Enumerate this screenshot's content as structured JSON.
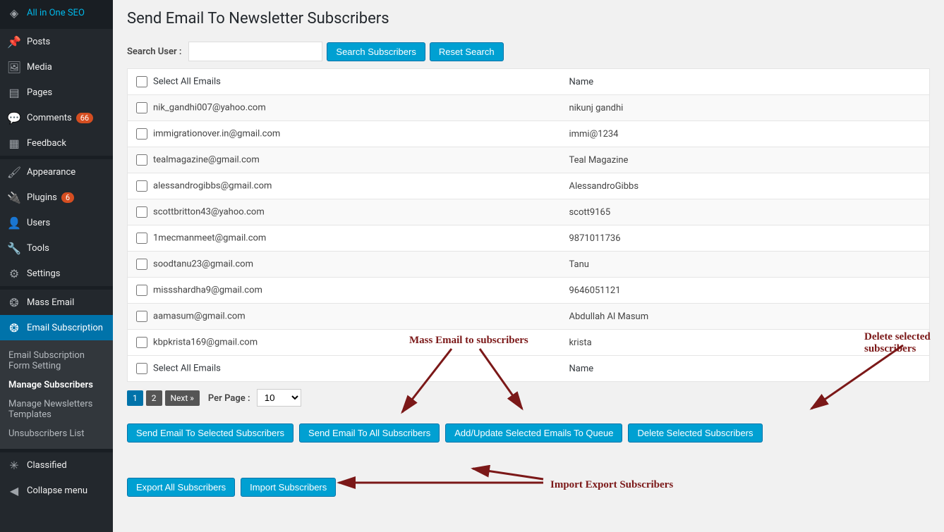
{
  "sidebar": {
    "items": [
      {
        "label": "All in One SEO",
        "icon": "●"
      },
      {
        "label": "Posts",
        "icon": "✎"
      },
      {
        "label": "Media",
        "icon": "▣"
      },
      {
        "label": "Pages",
        "icon": "▤"
      },
      {
        "label": "Comments",
        "icon": "💬",
        "badge": "66"
      },
      {
        "label": "Feedback",
        "icon": "▦"
      },
      {
        "label": "Appearance",
        "icon": "✂"
      },
      {
        "label": "Plugins",
        "icon": "⚡",
        "badge": "6"
      },
      {
        "label": "Users",
        "icon": "👤"
      },
      {
        "label": "Tools",
        "icon": "🔧"
      },
      {
        "label": "Settings",
        "icon": "⚙"
      },
      {
        "label": "Mass Email",
        "icon": "❂"
      },
      {
        "label": "Email Subscription",
        "icon": "❂",
        "current": true
      },
      {
        "label": "Classified",
        "icon": "✱"
      },
      {
        "label": "Collapse menu",
        "icon": "◀"
      }
    ],
    "submenu": [
      {
        "label": "Email Subscription Form Setting"
      },
      {
        "label": "Manage Subscribers",
        "current": true
      },
      {
        "label": "Manage Newsletters Templates"
      },
      {
        "label": "Unsubscribers List"
      }
    ]
  },
  "page": {
    "title": "Send Email To Newsletter Subscribers",
    "search_label": "Search User :",
    "search_btn": "Search Subscribers",
    "reset_btn": "Reset Search"
  },
  "table": {
    "select_all": "Select All Emails",
    "name_header": "Name",
    "rows": [
      {
        "email": "nik_gandhi007@yahoo.com",
        "name": "nikunj gandhi"
      },
      {
        "email": "immigrationover.in@gmail.com",
        "name": "immi@1234"
      },
      {
        "email": "tealmagazine@gmail.com",
        "name": "Teal Magazine"
      },
      {
        "email": "alessandrogibbs@gmail.com",
        "name": "AlessandroGibbs"
      },
      {
        "email": "scottbritton43@yahoo.com",
        "name": "scott9165"
      },
      {
        "email": "1mecmanmeet@gmail.com",
        "name": "9871011736"
      },
      {
        "email": "soodtanu23@gmail.com",
        "name": "Tanu"
      },
      {
        "email": "missshardha9@gmail.com",
        "name": "9646051121"
      },
      {
        "email": "aamasum@gmail.com",
        "name": "Abdullah Al Masum"
      },
      {
        "email": "kbpkrista169@gmail.com",
        "name": "krista"
      }
    ]
  },
  "pager": {
    "pages": [
      "1",
      "2",
      "Next »"
    ],
    "perpage_label": "Per Page :",
    "perpage_value": "10"
  },
  "actions": {
    "send_selected": "Send Email To Selected Subscribers",
    "send_all": "Send Email To All Subscribers",
    "add_queue": "Add/Update Selected Emails To Queue",
    "delete": "Delete Selected Subscribers",
    "export": "Export All Subscribers",
    "import": "Import Subscribers"
  },
  "annotations": {
    "mass": "Mass Email to subscribers",
    "delete": "Delete selected subscribers",
    "impexp": "Import Export Subscribers"
  }
}
